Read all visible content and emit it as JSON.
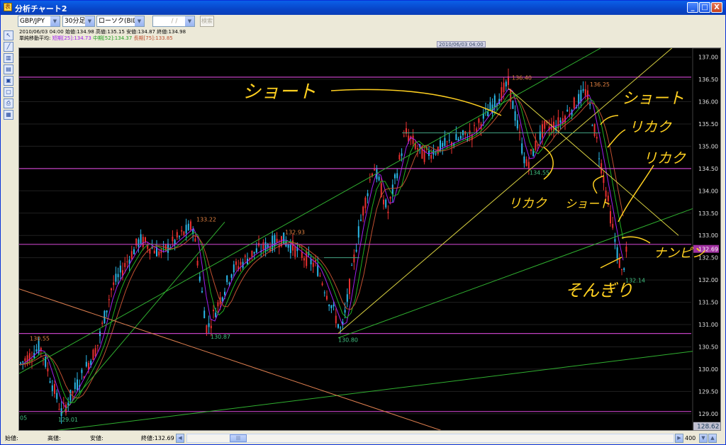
{
  "window": {
    "title": "分析チャート2",
    "minimize": "_",
    "maximize": "□",
    "close": "X"
  },
  "toolbar": {
    "symbol": "GBP/JPY",
    "period": "30分足",
    "chart_type": "ローソク(BID)",
    "date": "/ /",
    "search_label": "検索"
  },
  "info": {
    "ohlc_line": "2010/06/03 04:00  始値:134.98  高値:135.15  安値:134.87  終値:134.98",
    "ma_prefix": "単純移動平均:",
    "ma_short": "短期[25]:134.73",
    "ma_mid": "中期[52]:134.37",
    "ma_long": "長期[75]:133.85"
  },
  "date_marker": "2010/06/03 04:00",
  "sidebar_icons": [
    "cursor-icon",
    "line-draw-icon",
    "chart-type-icon",
    "indicator-icon",
    "window-icon",
    "text-icon",
    "print-icon",
    "settings-icon"
  ],
  "chart_data": {
    "type": "candlestick",
    "price_axis_labels": [
      "137.00",
      "136.50",
      "136.00",
      "135.50",
      "135.00",
      "134.50",
      "134.00",
      "133.50",
      "133.00",
      "132.50",
      "132.00",
      "131.50",
      "131.00",
      "130.50",
      "130.00",
      "129.50",
      "129.00"
    ],
    "y_range": [
      128.6,
      137.2
    ],
    "current_price": "132.69",
    "low_marker": "128.62",
    "annotations_price": [
      {
        "text": "130.55",
        "value": 130.55
      },
      {
        "text": "129.01",
        "value": 129.01
      },
      {
        "text": "133.22",
        "value": 133.22
      },
      {
        "text": "130.87",
        "value": 130.87
      },
      {
        "text": "132.93",
        "value": 132.93
      },
      {
        "text": "130.80",
        "value": 130.8
      },
      {
        "text": "136.40",
        "value": 136.4
      },
      {
        "text": "134.55",
        "value": 134.55
      },
      {
        "text": "136.25",
        "value": 136.25
      },
      {
        "text": "132.14",
        "value": 132.14
      }
    ],
    "horizontal_levels": [
      136.55,
      134.5,
      132.8,
      130.8,
      129.05
    ],
    "left_edge_label": "05",
    "handwritten_notes": [
      "ショート",
      "リカク",
      "ショート",
      "リカク",
      "リカク",
      "ショート",
      "ナンピン",
      "そんぎり"
    ],
    "moving_averages": [
      {
        "name": "短期[25]",
        "color": "#a020f0"
      },
      {
        "name": "中期[52]",
        "color": "#20b020"
      },
      {
        "name": "長期[75]",
        "color": "#c05030"
      }
    ]
  },
  "status": {
    "open_label": "始値:",
    "high_label": "高値:",
    "low_label": "安値:",
    "close_label": "終値:132.69",
    "zoom": "400"
  },
  "colors": {
    "bull": "#2ab8e8",
    "bear": "#e83030",
    "level": "#c040c0",
    "trend_green": "#30b030",
    "trend_yellow": "#d8d040",
    "trend_orange": "#e08050",
    "annotation": "#ffd020"
  }
}
